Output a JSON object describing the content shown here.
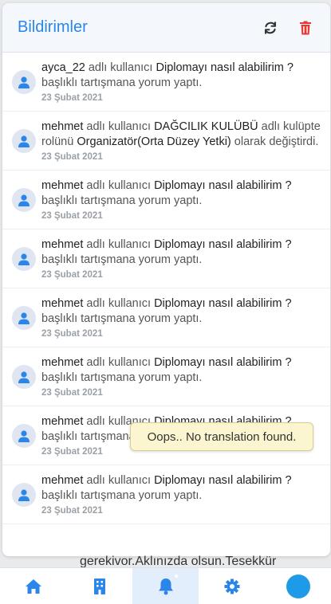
{
  "header": {
    "title": "Bildirimler"
  },
  "notifications": [
    {
      "user": "ayca_22",
      "p1": " adlı kullanıcı ",
      "target": "Diplomayı nasıl alabilirim ?",
      "p2": " başlıklı tartışmana yorum yaptı.",
      "date": "23 Şubat 2021"
    },
    {
      "user": "mehmet",
      "p1": " adlı kullanıcı ",
      "target": "DAĞCILIK KULÜBÜ",
      "p2": " adlı kulüpte rolünü ",
      "role": "Organizatör(Orta Düzey Yetki)",
      "p3": " olarak değiştirdi.",
      "date": "23 Şubat 2021"
    },
    {
      "user": "mehmet",
      "p1": " adlı kullanıcı ",
      "target": "Diplomayı nasıl alabilirim ?",
      "p2": " başlıklı tartışmana yorum yaptı.",
      "date": "23 Şubat 2021"
    },
    {
      "user": "mehmet",
      "p1": " adlı kullanıcı ",
      "target": "Diplomayı nasıl alabilirim ?",
      "p2": " başlıklı tartışmana yorum yaptı.",
      "date": "23 Şubat 2021"
    },
    {
      "user": "mehmet",
      "p1": " adlı kullanıcı ",
      "target": "Diplomayı nasıl alabilirim ?",
      "p2": " başlıklı tartışmana yorum yaptı.",
      "date": "23 Şubat 2021"
    },
    {
      "user": "mehmet",
      "p1": " adlı kullanıcı ",
      "target": "Diplomayı nasıl alabilirim ?",
      "p2": " başlıklı tartışmana yorum yaptı.",
      "date": "23 Şubat 2021"
    },
    {
      "user": "mehmet",
      "p1": " adlı kullanıcı ",
      "target": "Diplomayı nasıl alabilirim ?",
      "p2": " başlıklı tartışmana yorum yaptı.",
      "date": "23 Şubat 2021"
    },
    {
      "user": "mehmet",
      "p1": " adlı kullanıcı ",
      "target": "Diplomayı nasıl alabilirim ?",
      "p2": " başlıklı tartışmana yorum yaptı.",
      "date": "23 Şubat 2021"
    }
  ],
  "background_text": "gerekivor.Aklınızda olsun.Tesekkür",
  "tooltip": "Oops.. No translation found.",
  "tabs": [
    {
      "icon": "home-icon"
    },
    {
      "icon": "building-icon"
    },
    {
      "icon": "bell-icon",
      "active": true
    },
    {
      "icon": "gear-icon"
    },
    {
      "icon": "brand-logo"
    }
  ],
  "colors": {
    "accent": "#2a86e8",
    "delete": "#e53935",
    "active_tab_bg": "#e2eefb"
  }
}
